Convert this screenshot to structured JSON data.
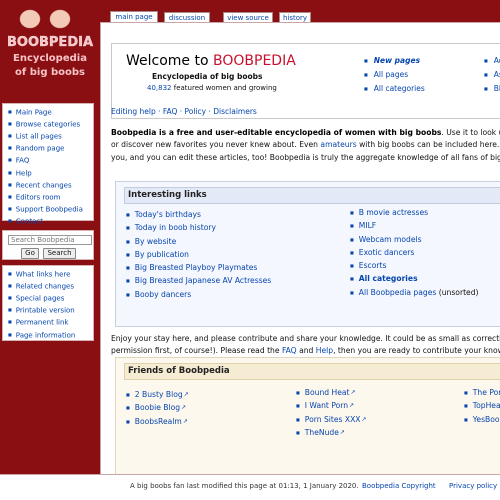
{
  "tabs": [
    {
      "label": "main page",
      "active": true
    },
    {
      "label": "discussion",
      "active": false
    },
    {
      "label": "view source",
      "active": false
    },
    {
      "label": "history",
      "active": false
    }
  ],
  "logo": {
    "line1": "BOOBPEDIA",
    "line2": "Encyclopedia",
    "line3": "of big boobs"
  },
  "sidebar": {
    "nav": [
      "Main Page",
      "Browse categories",
      "List all pages",
      "Random page",
      "FAQ",
      "Help",
      "Recent changes",
      "Editors room",
      "Support Boobpedia",
      "Contact"
    ],
    "search": {
      "label": "Search Boobpedia",
      "go": "Go",
      "search": "Search"
    },
    "tools": [
      "What links here",
      "Related changes",
      "Special pages",
      "Printable version",
      "Permanent link",
      "Page information"
    ]
  },
  "welcome": {
    "title_prefix": "Welcome to ",
    "title_brand": "BOOBPEDIA",
    "subtitle": "Encyclopedia of big boobs",
    "count_number": "40,832",
    "count_text": " featured women and growing",
    "links_col1": [
      "New pages",
      "All pages",
      "All categories"
    ],
    "links_col2": [
      "Adul",
      "Asia",
      "BBW"
    ]
  },
  "toplinks": "Editing help · FAQ · Policy · Disclaimers",
  "intro": {
    "bold": "Boobpedia is a free and user-editable encyclopedia of women with big boobs",
    "line1_rest": ". Use it to look up your fa",
    "line2_a": "or discover new favorites you never knew about. Even ",
    "line2_link": "amateurs",
    "line2_b": " with big boobs can be included here. The m",
    "line3": "you, and you can edit these articles, too! Boobpedia is truly the aggregate knowledge of all fans of big breast"
  },
  "interesting": {
    "title": "Interesting links",
    "col1": [
      "Today's birthdays",
      "Today in boob history",
      "By website",
      "By publication",
      "Big Breasted Playboy Playmates",
      "Big Breasted Japanese AV Actresses",
      "Booby dancers"
    ],
    "col2": [
      "B movie actresses",
      "MILF",
      "Webcam models",
      "Exotic dancers",
      "Escorts",
      "All categories"
    ],
    "col2_last_link": "All Boobpedia pages",
    "col2_last_rest": " (unsorted)"
  },
  "para2": {
    "line1": "Enjoy your stay here, and please contribute and share your knowledge. It could be as small as correcting a t",
    "line2_a": "permission first, of course!). Please read the ",
    "faq": "FAQ",
    "and": " and ",
    "help": "Help",
    "line2_b": ", then you are ready to contribute your knowledge"
  },
  "friends": {
    "title": "Friends of Boobpedia",
    "col1": [
      "2 Busty Blog",
      "Boobie Blog",
      "BoobsRealm"
    ],
    "col2": [
      "Bound Heat",
      "I Want Porn",
      "Porn Sites XXX",
      "TheNude"
    ],
    "col3": [
      "The Por",
      "TopHeav",
      "YesBoob"
    ]
  },
  "footer": {
    "modified": "A big boobs fan last modified this page at 01:13, 1 January 2020.",
    "copyright": "Boobpedia Copyright",
    "privacy": "Privacy policy"
  },
  "colors": {
    "brand": "#c8102e",
    "sidebar": "#8a0f12",
    "link": "#0645ad"
  }
}
